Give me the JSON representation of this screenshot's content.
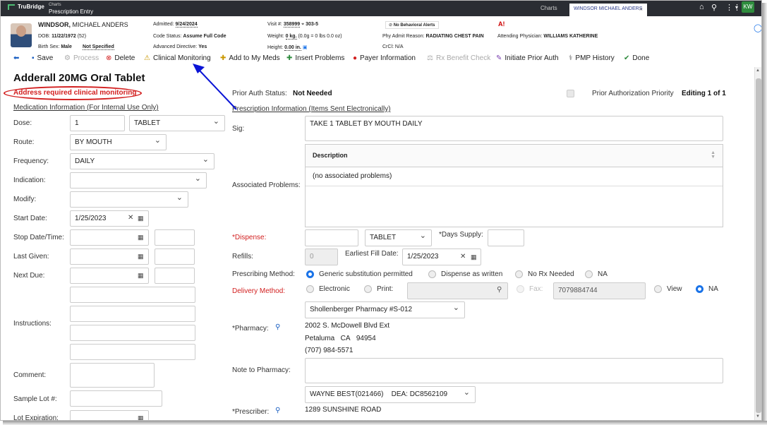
{
  "app": {
    "brand": "TruBridge",
    "crumb_small": "Charts",
    "crumb_big": "Prescription Entry"
  },
  "tabs": {
    "charts": "Charts",
    "patient": "WINDSOR MICHAEL ANDERS"
  },
  "user": {
    "initials": "KW"
  },
  "patient": {
    "last": "WINDSOR,",
    "first": " MICHAEL ANDERS",
    "dob_label": "DOB:",
    "dob": "11/22/1972",
    "age": "(52)",
    "birth_sex_label": "Birth Sex:",
    "birth_sex": "Male",
    "gender": "Not Specified",
    "admitted_label": "Admitted:",
    "admitted": "9/24/2024",
    "code_label": "Code Status:",
    "code": "Assume Full Code",
    "adv_label": "Advanced Directive:",
    "adv": "Yes",
    "visit_label": "Visit #:",
    "visit": "358999",
    "room": "303-5",
    "weight_label": "Weight:",
    "weight": "0 kg.",
    "weight_note": "(0.0g = 0 lbs 0.0 oz)",
    "height_label": "Height:",
    "height": "0.00 in.",
    "behavior_alert": "No Behavioral Alerts",
    "admit_reason_label": "Phy Admit Reason:",
    "admit_reason": "RADIATING CHEST PAIN",
    "crcl_label": "CrCl:",
    "crcl": "N/A",
    "attending_label": "Attending Physician:",
    "attending": "WILLIAMS KATHERINE"
  },
  "toolbar": {
    "save": "Save",
    "process": "Process",
    "delete": "Delete",
    "clinical": "Clinical Monitoring",
    "add_meds": "Add to My Meds",
    "insert_problems": "Insert Problems",
    "payer": "Payer Information",
    "rx_benefit": "Rx Benefit Check",
    "prior_auth": "Initiate Prior Auth",
    "pmp": "PMP History",
    "done": "Done"
  },
  "med": {
    "title": "Adderall 20MG Oral Tablet",
    "warning": "Address required clinical monitoring",
    "section": "Medication Information (For Internal Use Only)",
    "dose_label": "Dose:",
    "dose": "1",
    "dose_unit": "TABLET",
    "route_label": "Route:",
    "route": "BY MOUTH",
    "freq_label": "Frequency:",
    "freq": "DAILY",
    "indication_label": "Indication:",
    "modify_label": "Modify:",
    "start_label": "Start Date:",
    "start": "1/25/2023",
    "stop_label": "Stop Date/Time:",
    "last_label": "Last Given:",
    "next_label": "Next Due:",
    "instr_label": "Instructions:",
    "comment_label": "Comment:",
    "lot_label": "Sample Lot #:",
    "exp_label": "Lot Expiration:"
  },
  "rx": {
    "auth_label": "Prior Auth Status:",
    "auth": "Not Needed",
    "priority_label": "Prior Authorization Priority",
    "editing": "Editing 1 of 1",
    "section": "Prescription Information (Items Sent Electronically)",
    "sig_label": "Sig:",
    "sig": "TAKE 1 TABLET BY MOUTH DAILY",
    "problems_label": "Associated Problems:",
    "desc_head": "Description",
    "no_problems": "(no associated problems)",
    "dispense_label": "*Dispense:",
    "dispense_unit": "TABLET",
    "days_label": "*Days Supply:",
    "refills_label": "Refills:",
    "refills": "0",
    "earliest_label": "Earliest Fill Date:",
    "earliest": "1/25/2023",
    "method_label": "Prescribing Method:",
    "m_generic": "Generic substitution permitted",
    "m_daw": "Dispense as written",
    "m_norx": "No Rx Needed",
    "m_na": "NA",
    "delivery_label": "Delivery Method:",
    "d_elec": "Electronic",
    "d_print": "Print:",
    "d_fax": "Fax:",
    "fax": "7079884744",
    "d_view": "View",
    "d_na": "NA",
    "pharmacy_label": "*Pharmacy:",
    "pharmacy": "Shollenberger Pharmacy #S-012",
    "ph_addr1": "2002 S. McDowell Blvd Ext",
    "ph_city": "Petaluma",
    "ph_state": "CA",
    "ph_zip": "94954",
    "ph_phone": "(707) 984-5571",
    "note_label": "Note to Pharmacy:",
    "prescriber_label": "*Prescriber:",
    "prescriber": "WAYNE BEST(021466)    DEA: DC8562109",
    "pr_addr": "1289 SUNSHINE ROAD"
  },
  "colors": {
    "alert_red": "#d21f1f",
    "annotation_blue": "#0a14d6",
    "radio_blue": "#1a73e8"
  }
}
